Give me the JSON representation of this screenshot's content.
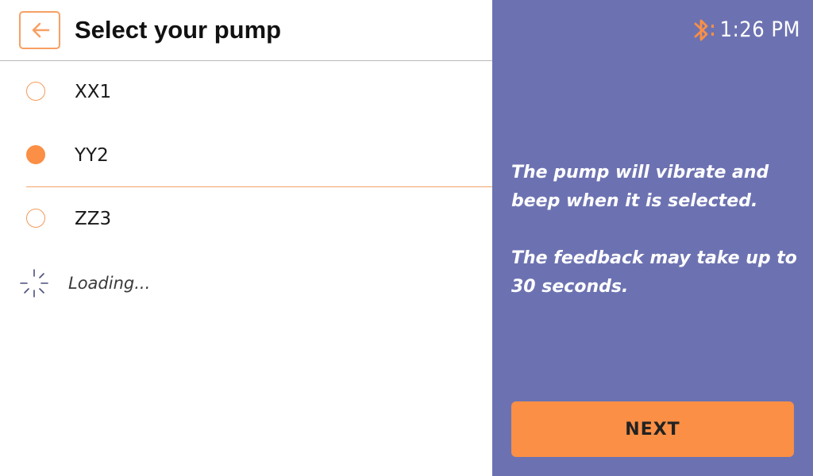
{
  "header": {
    "title": "Select your pump"
  },
  "pumps": [
    {
      "label": "XX1",
      "selected": false
    },
    {
      "label": "YY2",
      "selected": true
    },
    {
      "label": "ZZ3",
      "selected": false
    }
  ],
  "loading": {
    "text": "Loading..."
  },
  "status": {
    "time": "1:26 PM",
    "bluetooth_icon": "bluetooth-icon"
  },
  "info": {
    "line1": "The pump will vibrate and beep when it is selected.",
    "line2": "The feedback may take up to 30 seconds."
  },
  "next_button": {
    "label": "NEXT"
  },
  "colors": {
    "accent": "#fa8f45",
    "panel": "#6c72b1",
    "divider": "#b9b9b9"
  }
}
